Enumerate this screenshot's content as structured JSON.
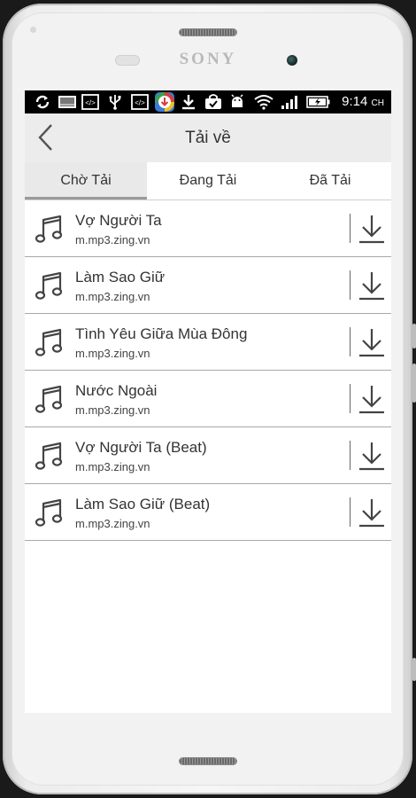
{
  "device": {
    "brand": "SONY"
  },
  "status_bar": {
    "time": "9:14",
    "time_suffix": "CH",
    "icons": [
      "sync-icon",
      "gallery-icon",
      "code-icon",
      "usb-icon",
      "code-icon",
      "download-manager-icon",
      "download-icon",
      "shopping-bag-icon",
      "android-debug-icon",
      "wifi-icon",
      "signal-icon",
      "battery-icon"
    ]
  },
  "header": {
    "title": "Tải về",
    "back_icon": "chevron-left-icon"
  },
  "tabs": [
    {
      "label": "Chờ Tải",
      "active": true
    },
    {
      "label": "Đang Tải",
      "active": false
    },
    {
      "label": "Đã Tải",
      "active": false
    }
  ],
  "downloads": [
    {
      "title": "Vợ Người Ta",
      "source": "m.mp3.zing.vn"
    },
    {
      "title": "Làm Sao Giữ",
      "source": "m.mp3.zing.vn"
    },
    {
      "title": "Tình Yêu Giữa Mùa Đông",
      "source": "m.mp3.zing.vn"
    },
    {
      "title": "Nước Ngoài",
      "source": "m.mp3.zing.vn"
    },
    {
      "title": "Vợ Người Ta (Beat)",
      "source": "m.mp3.zing.vn"
    },
    {
      "title": "Làm Sao Giữ (Beat)",
      "source": "m.mp3.zing.vn"
    }
  ],
  "colors": {
    "status_bar": "#000000",
    "app_bar": "#ececec",
    "active_tab": "#e9e9e9",
    "text": "#333333"
  }
}
